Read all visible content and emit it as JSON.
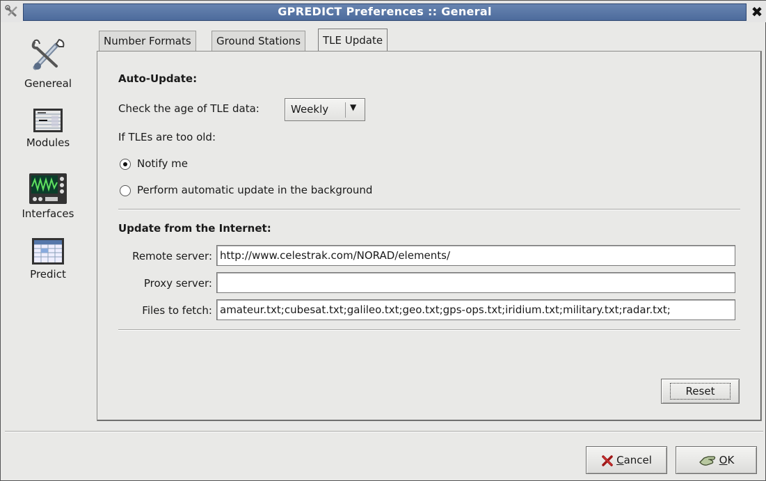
{
  "window": {
    "title": "GPREDICT Preferences :: General",
    "close_symbol": "✖"
  },
  "sidebar": {
    "items": [
      {
        "label": "Genereal",
        "icon": "tools-icon"
      },
      {
        "label": "Modules",
        "icon": "module-icon"
      },
      {
        "label": "Interfaces",
        "icon": "interface-icon"
      },
      {
        "label": "Predict",
        "icon": "predict-icon"
      }
    ]
  },
  "tabs": [
    {
      "label": "Number Formats",
      "active": false
    },
    {
      "label": "Ground Stations",
      "active": false
    },
    {
      "label": "TLE Update",
      "active": true
    }
  ],
  "auto_update": {
    "heading": "Auto-Update:",
    "age_label": "Check the age of TLE data:",
    "age_value": "Weekly",
    "too_old_label": "If TLEs are too old:",
    "options": [
      {
        "label": "Notify me",
        "selected": true
      },
      {
        "label": "Perform automatic update in the background",
        "selected": false
      }
    ]
  },
  "internet": {
    "heading": "Update from the Internet:",
    "remote_label": "Remote server:",
    "remote_value": "http://www.celestrak.com/NORAD/elements/",
    "proxy_label": "Proxy server:",
    "proxy_value": "",
    "files_label": "Files to fetch:",
    "files_value": "amateur.txt;cubesat.txt;galileo.txt;geo.txt;gps-ops.txt;iridium.txt;military.txt;radar.txt;"
  },
  "buttons": {
    "reset": "Reset",
    "cancel_mnemonic": "C",
    "cancel_rest": "ancel",
    "ok_mnemonic": "O",
    "ok_rest": "K"
  }
}
